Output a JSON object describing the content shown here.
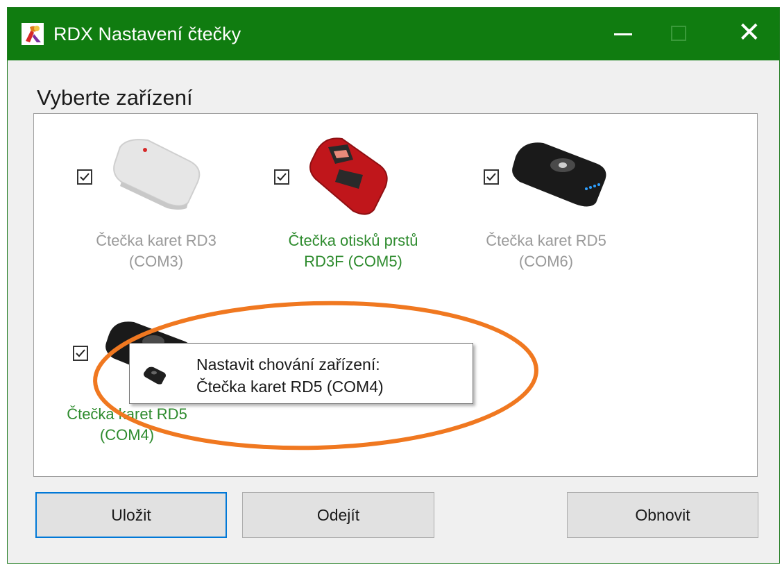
{
  "window": {
    "title": "RDX Nastavení čtečky",
    "title_bar_color": "#107c10",
    "controls": [
      "minimize-icon",
      "maximize-icon",
      "close-icon"
    ]
  },
  "section_heading": "Vyberte zařízení",
  "devices": [
    {
      "label": "Čtečka karet RD3\n(COM3)",
      "checked": true,
      "label_color": "#9a9a9a",
      "icon": "white-card-reader-icon"
    },
    {
      "label": "Čtečka otisků prstů\nRD3F (COM5)",
      "checked": true,
      "label_color": "#2e8b2e",
      "icon": "red-fingerprint-reader-icon"
    },
    {
      "label": "Čtečka karet RD5\n(COM6)",
      "checked": true,
      "label_color": "#9a9a9a",
      "icon": "black-card-reader-icon"
    },
    {
      "label": "Čtečka karet RD5\n(COM4)",
      "checked": true,
      "label_color": "#2e8b2e",
      "icon": "black-card-reader-icon"
    }
  ],
  "tooltip": {
    "text": "Nastavit chování zařízení:\nČtečka karet RD5 (COM4)",
    "icon": "card-reader-icon"
  },
  "highlight_color": "#f07820",
  "buttons": {
    "save": "Uložit",
    "leave": "Odejít",
    "refresh": "Obnovit"
  }
}
